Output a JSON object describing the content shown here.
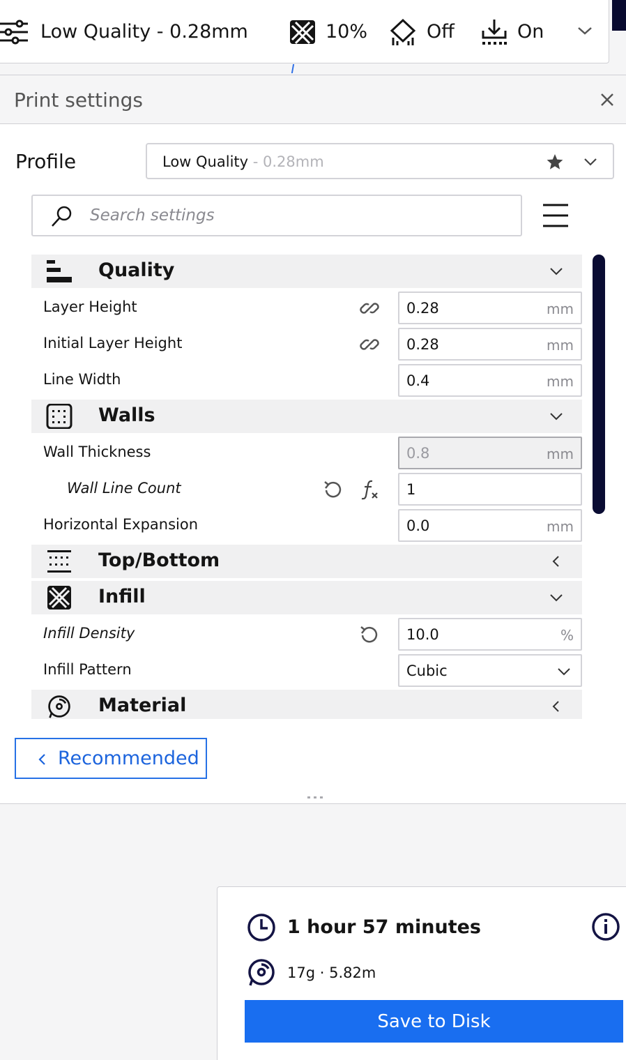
{
  "toolbar": {
    "profile": {
      "icon": "sliders-icon",
      "label": "Low Quality - 0.28mm"
    },
    "infill": {
      "icon": "infill-icon",
      "value": "10%"
    },
    "support": {
      "icon": "support-icon",
      "value": "Off"
    },
    "adhesion": {
      "icon": "adhesion-icon",
      "value": "On"
    },
    "expand_icon": "chevron-down-icon"
  },
  "panel": {
    "title": "Print settings",
    "close_icon": "close-icon",
    "profile": {
      "label": "Profile",
      "name": "Low Quality",
      "sub": " - 0.28mm",
      "favorite_icon": "star-icon",
      "dropdown_icon": "chevron-down-icon"
    },
    "search": {
      "placeholder": "Search settings",
      "icon": "search-icon",
      "menu_icon": "hamburger-menu-icon"
    },
    "categories": {
      "quality": {
        "label": "Quality",
        "icon": "quality-icon",
        "expanded": true,
        "settings": {
          "layer_height": {
            "label": "Layer Height",
            "value": "0.28",
            "unit": "mm",
            "icon": "link-icon"
          },
          "initial_layer_height": {
            "label": "Initial Layer Height",
            "value": "0.28",
            "unit": "mm",
            "icon": "link-icon"
          },
          "line_width": {
            "label": "Line Width",
            "value": "0.4",
            "unit": "mm"
          }
        }
      },
      "walls": {
        "label": "Walls",
        "icon": "walls-icon",
        "expanded": true,
        "settings": {
          "wall_thickness": {
            "label": "Wall Thickness",
            "value": "0.8",
            "unit": "mm",
            "disabled": true
          },
          "wall_line_count": {
            "label": "Wall Line Count",
            "value": "1",
            "icons": [
              "reset-icon",
              "function-icon"
            ]
          },
          "horizontal_expansion": {
            "label": "Horizontal Expansion",
            "value": "0.0",
            "unit": "mm"
          }
        }
      },
      "top_bottom": {
        "label": "Top/Bottom",
        "icon": "top-bottom-icon",
        "expanded": false
      },
      "infill": {
        "label": "Infill",
        "icon": "infill-icon",
        "expanded": true,
        "settings": {
          "infill_density": {
            "label": "Infill Density",
            "value": "10.0",
            "unit": "%",
            "icon": "reset-icon"
          },
          "infill_pattern": {
            "label": "Infill Pattern",
            "value": "Cubic"
          }
        }
      },
      "material": {
        "label": "Material",
        "icon": "material-spool-icon",
        "expanded": false
      }
    },
    "recommended_button": "Recommended"
  },
  "job": {
    "time_icon": "clock-icon",
    "print_time": "1 hour 57 minutes",
    "info_icon": "info-icon",
    "spool_icon": "spool-icon",
    "material_usage": "17g · 5.82m",
    "save_button": "Save to Disk"
  },
  "colors": {
    "accent_blue": "#196ef0",
    "link_blue": "#1c64dd",
    "navy": "#0a0c33"
  }
}
